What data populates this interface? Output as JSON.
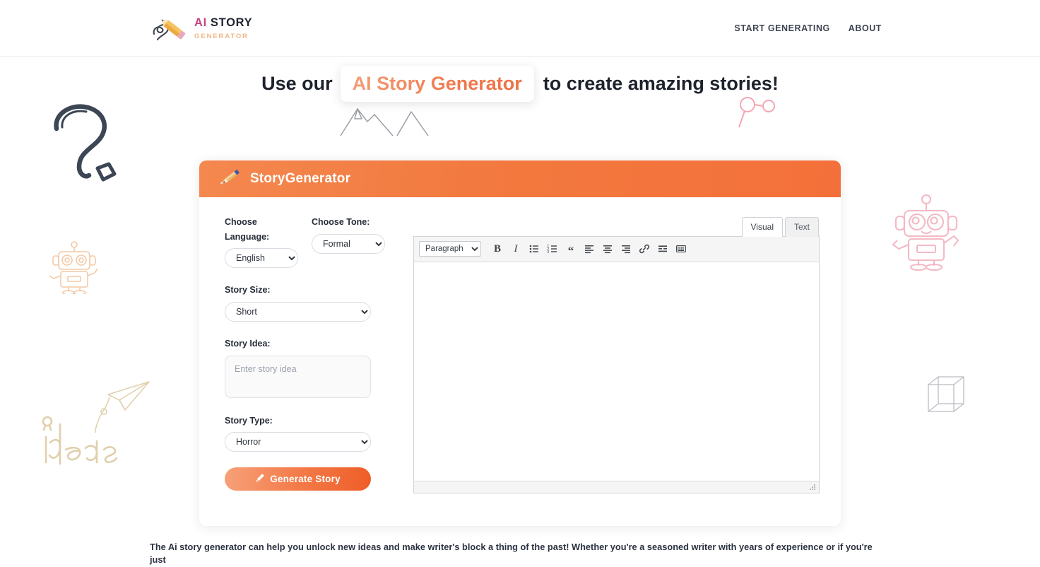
{
  "header": {
    "brand": {
      "icon": "pencil-scribble-logo-icon",
      "ai": "AI",
      "story": "STORY",
      "generator": "GENERATOR"
    },
    "nav": [
      {
        "label": "START GENERATING",
        "name": "nav-start-generating"
      },
      {
        "label": "ABOUT",
        "name": "nav-about"
      }
    ]
  },
  "hero": {
    "pre": "Use our",
    "highlight": "AI Story Generator",
    "post": "to create amazing stories!"
  },
  "generator": {
    "panel_icon": "pencil-writing-icon",
    "panel_title": "StoryGenerator",
    "language": {
      "label": "Choose Language:",
      "label_line1": "Choose",
      "label_line2": "Language:",
      "value": "English",
      "options": [
        "English"
      ]
    },
    "tone": {
      "label": "Choose Tone:",
      "value": "Formal",
      "options": [
        "Formal"
      ]
    },
    "size": {
      "label": "Story Size:",
      "value": "Short",
      "options": [
        "Short"
      ]
    },
    "idea": {
      "label": "Story Idea:",
      "value": "",
      "placeholder": "Enter story idea"
    },
    "type": {
      "label": "Story Type:",
      "value": "Horror",
      "options": [
        "Horror"
      ]
    },
    "generate_button": {
      "label": "Generate Story",
      "icon": "pencil-icon"
    }
  },
  "editor": {
    "tabs": [
      {
        "label": "Visual",
        "name": "tab-visual",
        "active": true
      },
      {
        "label": "Text",
        "name": "tab-text",
        "active": false
      }
    ],
    "format_select": {
      "value": "Paragraph",
      "options": [
        "Paragraph"
      ]
    },
    "toolbar_buttons": [
      {
        "name": "bold-icon",
        "glyph": "B"
      },
      {
        "name": "italic-icon",
        "glyph": "I"
      },
      {
        "name": "bulleted-list-icon",
        "glyph": ""
      },
      {
        "name": "numbered-list-icon",
        "glyph": ""
      },
      {
        "name": "blockquote-icon",
        "glyph": "“"
      },
      {
        "name": "align-left-icon",
        "glyph": ""
      },
      {
        "name": "align-center-icon",
        "glyph": ""
      },
      {
        "name": "align-right-icon",
        "glyph": ""
      },
      {
        "name": "insert-link-icon",
        "glyph": ""
      },
      {
        "name": "read-more-icon",
        "glyph": ""
      },
      {
        "name": "toolbar-toggle-icon",
        "glyph": ""
      }
    ],
    "content": "",
    "placeholder": ""
  },
  "blurb": {
    "text": "The Ai story generator can help you unlock new ideas and make writer's block a thing of the past! Whether you're a seasoned writer with years of experience or if you're just"
  },
  "colors": {
    "accent_orange": "#ef7a4e",
    "accent_orange_dark": "#ef5d27",
    "brand_pink": "#c2457e",
    "brand_tan": "#f0b887",
    "text_dark": "#2e3444"
  },
  "doodles": [
    {
      "name": "question-mark-doodle",
      "color": "#3c4654"
    },
    {
      "name": "robot-doodle-left",
      "color": "#f3c9a6"
    },
    {
      "name": "paper-airplane-doodle",
      "color": "#e4d2ae"
    },
    {
      "name": "ideas-handwriting-doodle",
      "color": "#e0cfab"
    },
    {
      "name": "mountains-doodle",
      "color": "#8c8f96"
    },
    {
      "name": "molecule-doodle",
      "color": "#f5a5b4"
    },
    {
      "name": "robot-doodle-right",
      "color": "#f3b9c4"
    },
    {
      "name": "wireframe-cube-doodle",
      "color": "#b9bdc4"
    },
    {
      "name": "swirl-doodle",
      "color": "#f6cfd6"
    }
  ]
}
